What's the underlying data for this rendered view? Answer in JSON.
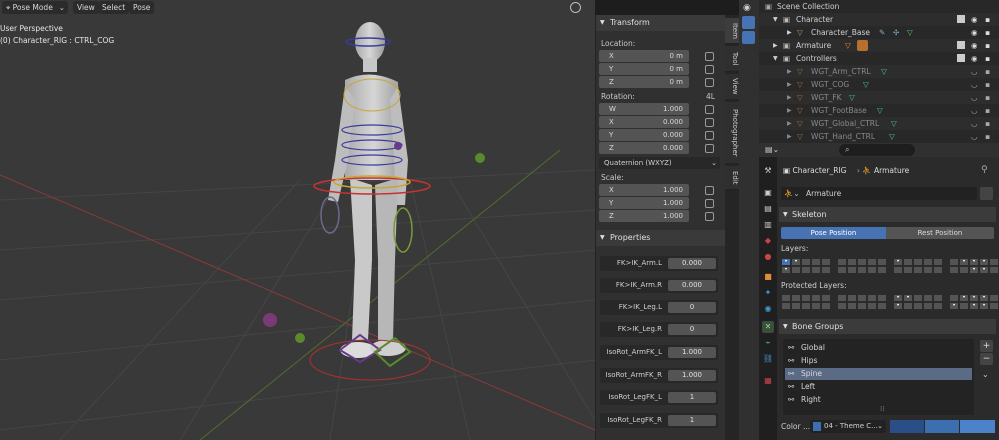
{
  "viewport": {
    "mode_label": "Pose Mode",
    "menu": [
      "View",
      "Select",
      "Pose"
    ],
    "perspective": "User Perspective",
    "active_object": "(0) Character_RIG : CTRL_COG"
  },
  "npanel": {
    "transform_title": "Transform",
    "location_label": "Location:",
    "location": [
      {
        "axis": "X",
        "value": "0 m"
      },
      {
        "axis": "Y",
        "value": "0 m"
      },
      {
        "axis": "Z",
        "value": "0 m"
      }
    ],
    "rotation_label": "Rotation:",
    "rotation_mode_tag": "4L",
    "rotation": [
      {
        "axis": "W",
        "value": "1.000"
      },
      {
        "axis": "X",
        "value": "0.000"
      },
      {
        "axis": "Y",
        "value": "0.000"
      },
      {
        "axis": "Z",
        "value": "0.000"
      }
    ],
    "rotation_mode": "Quaternion (WXYZ)",
    "scale_label": "Scale:",
    "scale": [
      {
        "axis": "X",
        "value": "1.000"
      },
      {
        "axis": "Y",
        "value": "1.000"
      },
      {
        "axis": "Z",
        "value": "1.000"
      }
    ],
    "properties_title": "Properties",
    "properties": [
      {
        "label": "FK>IK_Arm.L",
        "value": "0.000"
      },
      {
        "label": "FK>IK_Arm.R",
        "value": "0.000"
      },
      {
        "label": "FK>IK_Leg.L",
        "value": "0"
      },
      {
        "label": "FK>IK_Leg.R",
        "value": "0"
      },
      {
        "label": "IsoRot_ArmFK_L",
        "value": "1.000"
      },
      {
        "label": "IsoRot_ArmFK_R",
        "value": "1.000"
      },
      {
        "label": "IsoRot_LegFK_L",
        "value": "1"
      },
      {
        "label": "IsoRot_LegFK_R",
        "value": "1"
      }
    ],
    "tabs": [
      "Item",
      "Tool",
      "View",
      "Photographer",
      "Edit"
    ]
  },
  "outliner": {
    "rows": [
      {
        "name": "Scene Collection",
        "indent": 0
      },
      {
        "name": "Character",
        "indent": 1
      },
      {
        "name": "Character_Base",
        "indent": 2
      },
      {
        "name": "Armature",
        "indent": 1
      },
      {
        "name": "Controllers",
        "indent": 1
      },
      {
        "name": "WGT_Arm_CTRL",
        "indent": 2
      },
      {
        "name": "WGT_COG",
        "indent": 2
      },
      {
        "name": "WGT_FK",
        "indent": 2
      },
      {
        "name": "WGT_FootBase",
        "indent": 2
      },
      {
        "name": "WGT_Global_CTRL",
        "indent": 2
      },
      {
        "name": "WGT_Hand_CTRL",
        "indent": 2
      }
    ]
  },
  "properties_editor": {
    "breadcrumb_object": "Character_RIG",
    "breadcrumb_data": "Armature",
    "data_name": "Armature",
    "skeleton_title": "Skeleton",
    "pose_position": "Pose Position",
    "rest_position": "Rest Position",
    "layers_label": "Layers:",
    "protected_layers_label": "Protected Layers:",
    "bone_groups_title": "Bone Groups",
    "bone_groups": [
      "Global",
      "Hips",
      "Spine",
      "Left",
      "Right"
    ],
    "selected_group": "Spine",
    "color_label": "Color ...",
    "color_set": "04 - Theme C...",
    "colors": {
      "accent": "#4772b3",
      "selected": "#5b6b85",
      "theme_color": "#3b6fb0"
    }
  }
}
